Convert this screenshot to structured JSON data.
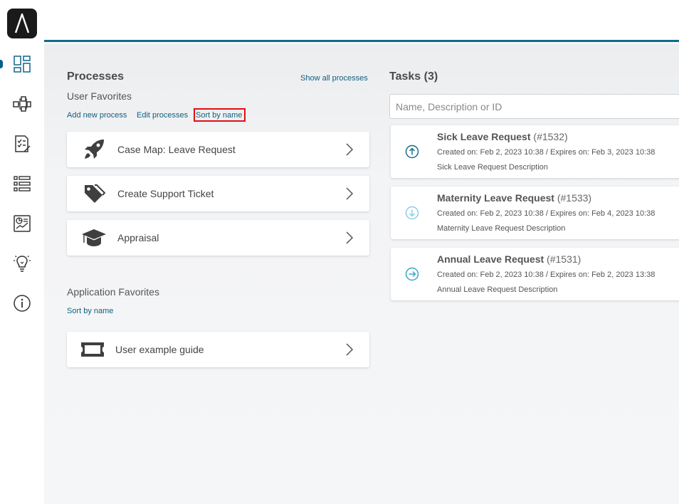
{
  "sidebar": {
    "logo": "axon-ivy-logo",
    "items": [
      {
        "name": "dashboard-icon",
        "active": true
      },
      {
        "name": "processes-icon"
      },
      {
        "name": "tasks-icon"
      },
      {
        "name": "cases-icon"
      },
      {
        "name": "statistics-icon"
      },
      {
        "name": "ideas-icon"
      },
      {
        "name": "info-icon"
      }
    ]
  },
  "processes": {
    "title": "Processes",
    "show_all": "Show all processes",
    "user_favorites_title": "User Favorites",
    "add_new": "Add new process",
    "edit": "Edit processes",
    "sort": "Sort by name",
    "items": [
      {
        "label": "Case Map: Leave Request",
        "icon": "rocket-icon"
      },
      {
        "label": "Create Support Ticket",
        "icon": "tags-icon"
      },
      {
        "label": "Appraisal",
        "icon": "graduation-cap-icon"
      }
    ],
    "app_favorites_title": "Application Favorites",
    "app_sort": "Sort by name",
    "app_items": [
      {
        "label": "User example guide",
        "icon": "ticket-icon"
      }
    ]
  },
  "tasks": {
    "title": "Tasks (3)",
    "search_placeholder": "Name, Description or ID",
    "items": [
      {
        "name": "Sick Leave Request",
        "id": "(#1532)",
        "dates": "Created on: Feb 2, 2023 10:38 / Expires on: Feb 3, 2023 10:38",
        "description": "Sick Leave Request Description",
        "priority": "high",
        "color": "#1a6e87"
      },
      {
        "name": "Maternity Leave Request",
        "id": "(#1533)",
        "dates": "Created on: Feb 2, 2023 10:38 / Expires on: Feb 4, 2023 10:38",
        "description": "Maternity Leave Request Description",
        "priority": "low",
        "color": "#8ccfe2"
      },
      {
        "name": "Annual Leave Request",
        "id": "(#1531)",
        "dates": "Created on: Feb 2, 2023 10:38 / Expires on: Feb 2, 2023 13:38",
        "description": "Annual Leave Request Description",
        "priority": "normal",
        "color": "#3aa7c8"
      }
    ]
  }
}
